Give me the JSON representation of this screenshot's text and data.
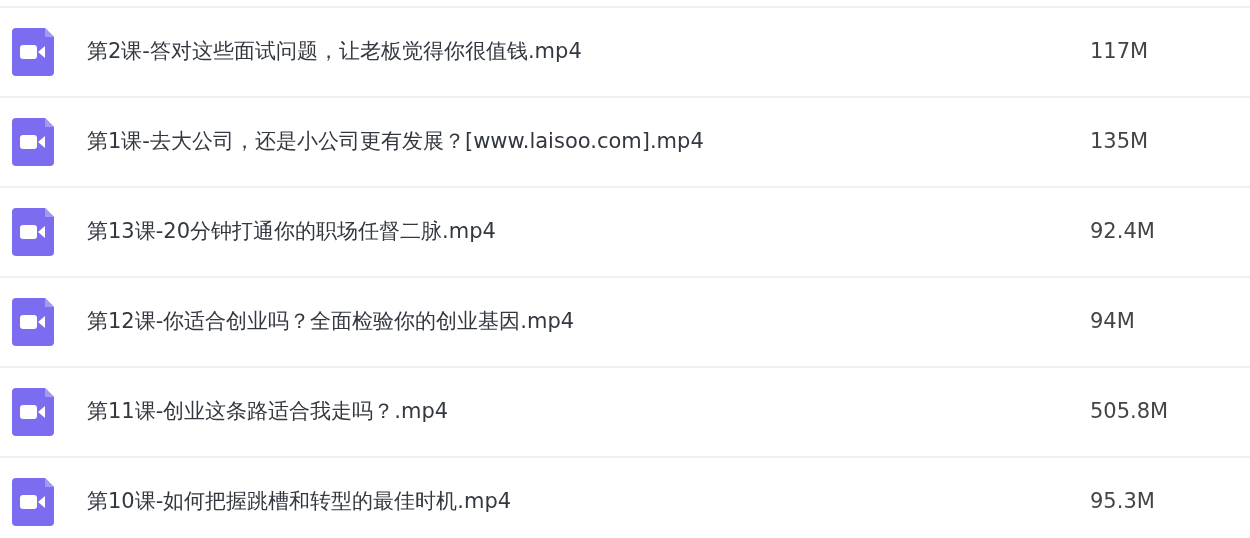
{
  "files": [
    {
      "name": "第2课-答对这些面试问题，让老板觉得你很值钱.mp4",
      "size": "117M"
    },
    {
      "name": "第1课-去大公司，还是小公司更有发展？[www.laisoo.com].mp4",
      "size": "135M"
    },
    {
      "name": "第13课-20分钟打通你的职场任督二脉.mp4",
      "size": "92.4M"
    },
    {
      "name": "第12课-你适合创业吗？全面检验你的创业基因.mp4",
      "size": "94M"
    },
    {
      "name": "第11课-创业这条路适合我走吗？.mp4",
      "size": "505.8M"
    },
    {
      "name": "第10课-如何把握跳槽和转型的最佳时机.mp4",
      "size": "95.3M"
    }
  ]
}
